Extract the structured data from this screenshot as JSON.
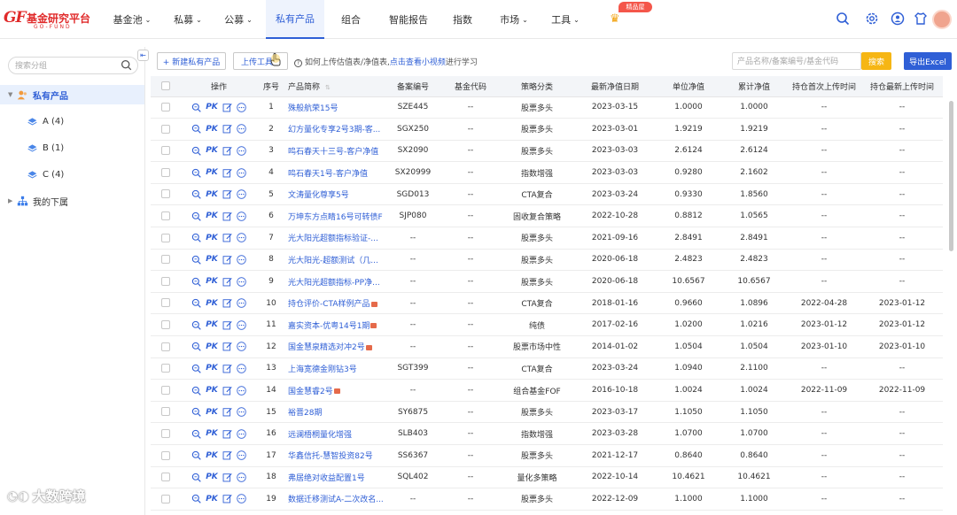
{
  "header": {
    "logo_mark": "GF",
    "logo_title": "基金研究平台",
    "logo_sub": "GO-FUND",
    "nav": [
      {
        "label": "基金池",
        "chevron": true
      },
      {
        "label": "私募",
        "chevron": true
      },
      {
        "label": "公募",
        "chevron": true
      },
      {
        "label": "私有产品",
        "chevron": false,
        "active": true
      },
      {
        "label": "组合",
        "chevron": false
      },
      {
        "label": "智能报告",
        "chevron": false
      },
      {
        "label": "指数",
        "chevron": false
      },
      {
        "label": "市场",
        "chevron": true
      },
      {
        "label": "工具",
        "chevron": true
      }
    ],
    "badge": "精品屋"
  },
  "sidebar": {
    "search_placeholder": "搜索分组",
    "root": "私有产品",
    "children": [
      "A (4)",
      "B (1)",
      "C (4)"
    ],
    "other": "我的下属"
  },
  "toolbar": {
    "new_label": "+ 新建私有产品",
    "upload_label": "上传工具",
    "hint_text": "如何上传估值表/净值表,",
    "hint_link": "点击查看小视频",
    "hint_tail": "进行学习",
    "search_placeholder": "产品名称/备案编号/基金代码",
    "search_label": "搜索",
    "export_label": "导出Excel"
  },
  "table": {
    "headers": [
      "操作",
      "序号",
      "产品简称",
      "备案编号",
      "基金代码",
      "策略分类",
      "最新净值日期",
      "单位净值",
      "累计净值",
      "持仓首次上传时间",
      "持仓最新上传时间"
    ],
    "rows": [
      [
        "1",
        "殊般航荣15号",
        "SZE445",
        "--",
        "股票多头",
        "2023-03-15",
        "1.0000",
        "1.0000",
        "--",
        "--"
      ],
      [
        "2",
        "幻方量化专享2号3期-客...",
        "SGX250",
        "--",
        "股票多头",
        "2023-03-01",
        "1.9219",
        "1.9219",
        "--",
        "--"
      ],
      [
        "3",
        "鸣石春天十三号-客户净值",
        "SX2090",
        "--",
        "股票多头",
        "2023-03-03",
        "2.6124",
        "2.6124",
        "--",
        "--"
      ],
      [
        "4",
        "鸣石春天1号-客户净值",
        "SX20999",
        "--",
        "指数增强",
        "2023-03-03",
        "0.9280",
        "2.1602",
        "--",
        "--"
      ],
      [
        "5",
        "文涛量化尊享5号",
        "SGD013",
        "--",
        "CTA复合",
        "2023-03-24",
        "0.9330",
        "1.8560",
        "--",
        "--"
      ],
      [
        "6",
        "万坤东方点睛16号可转债F",
        "SJP080",
        "--",
        "固收复合策略",
        "2022-10-28",
        "0.8812",
        "1.0565",
        "--",
        "--"
      ],
      [
        "7",
        "光大阳光超额指标验证-...",
        "--",
        "--",
        "股票多头",
        "2021-09-16",
        "2.8491",
        "2.8491",
        "--",
        "--"
      ],
      [
        "8",
        "光大阳光-超额测试（几...",
        "--",
        "--",
        "股票多头",
        "2020-06-18",
        "2.4823",
        "2.4823",
        "--",
        "--"
      ],
      [
        "9",
        "光大阳光超额指标-PP净...",
        "--",
        "--",
        "股票多头",
        "2020-06-18",
        "10.6567",
        "10.6567",
        "--",
        "--"
      ],
      [
        "10",
        "持仓评价-CTA样例产品",
        "--",
        "--",
        "CTA复合",
        "2018-01-16",
        "0.9660",
        "1.0896",
        "2022-04-28",
        "2023-01-12"
      ],
      [
        "11",
        "嘉实资本-优粤14号1期",
        "--",
        "--",
        "纯债",
        "2017-02-16",
        "1.0200",
        "1.0216",
        "2023-01-12",
        "2023-01-12"
      ],
      [
        "12",
        "国金慧泉精选对冲2号",
        "--",
        "--",
        "股票市场中性",
        "2014-01-02",
        "1.0504",
        "1.0504",
        "2023-01-10",
        "2023-01-10"
      ],
      [
        "13",
        "上海宽德金刚钻3号",
        "SGT399",
        "--",
        "CTA复合",
        "2023-03-24",
        "1.0940",
        "2.1100",
        "--",
        "--"
      ],
      [
        "14",
        "国金慧睿2号",
        "--",
        "--",
        "组合基金FOF",
        "2016-10-18",
        "1.0024",
        "1.0024",
        "2022-11-09",
        "2022-11-09"
      ],
      [
        "15",
        "裕晋28期",
        "SY6875",
        "--",
        "股票多头",
        "2023-03-17",
        "1.1050",
        "1.1050",
        "--",
        "--"
      ],
      [
        "16",
        "远澜梧桐量化增强",
        "SLB403",
        "--",
        "指数增强",
        "2023-03-28",
        "1.0700",
        "1.0700",
        "--",
        "--"
      ],
      [
        "17",
        "华鑫信托-慧智投资82号",
        "SS6367",
        "--",
        "股票多头",
        "2021-12-17",
        "0.8640",
        "0.8640",
        "--",
        "--"
      ],
      [
        "18",
        "弗居绝对收益配置1号",
        "SQL402",
        "--",
        "量化多策略",
        "2022-10-14",
        "10.4621",
        "10.4621",
        "--",
        "--"
      ],
      [
        "19",
        "数据迁移测试A-二次改名...",
        "--",
        "--",
        "股票多头",
        "2022-12-09",
        "1.1000",
        "1.1000",
        "--",
        "--"
      ]
    ],
    "tagged_rows": [
      10,
      11,
      12,
      14
    ]
  },
  "watermark": "大数跨境",
  "colors": {
    "accent": "#2f5fd6",
    "search_btn": "#f6b614",
    "logo": "#e02a2a"
  }
}
